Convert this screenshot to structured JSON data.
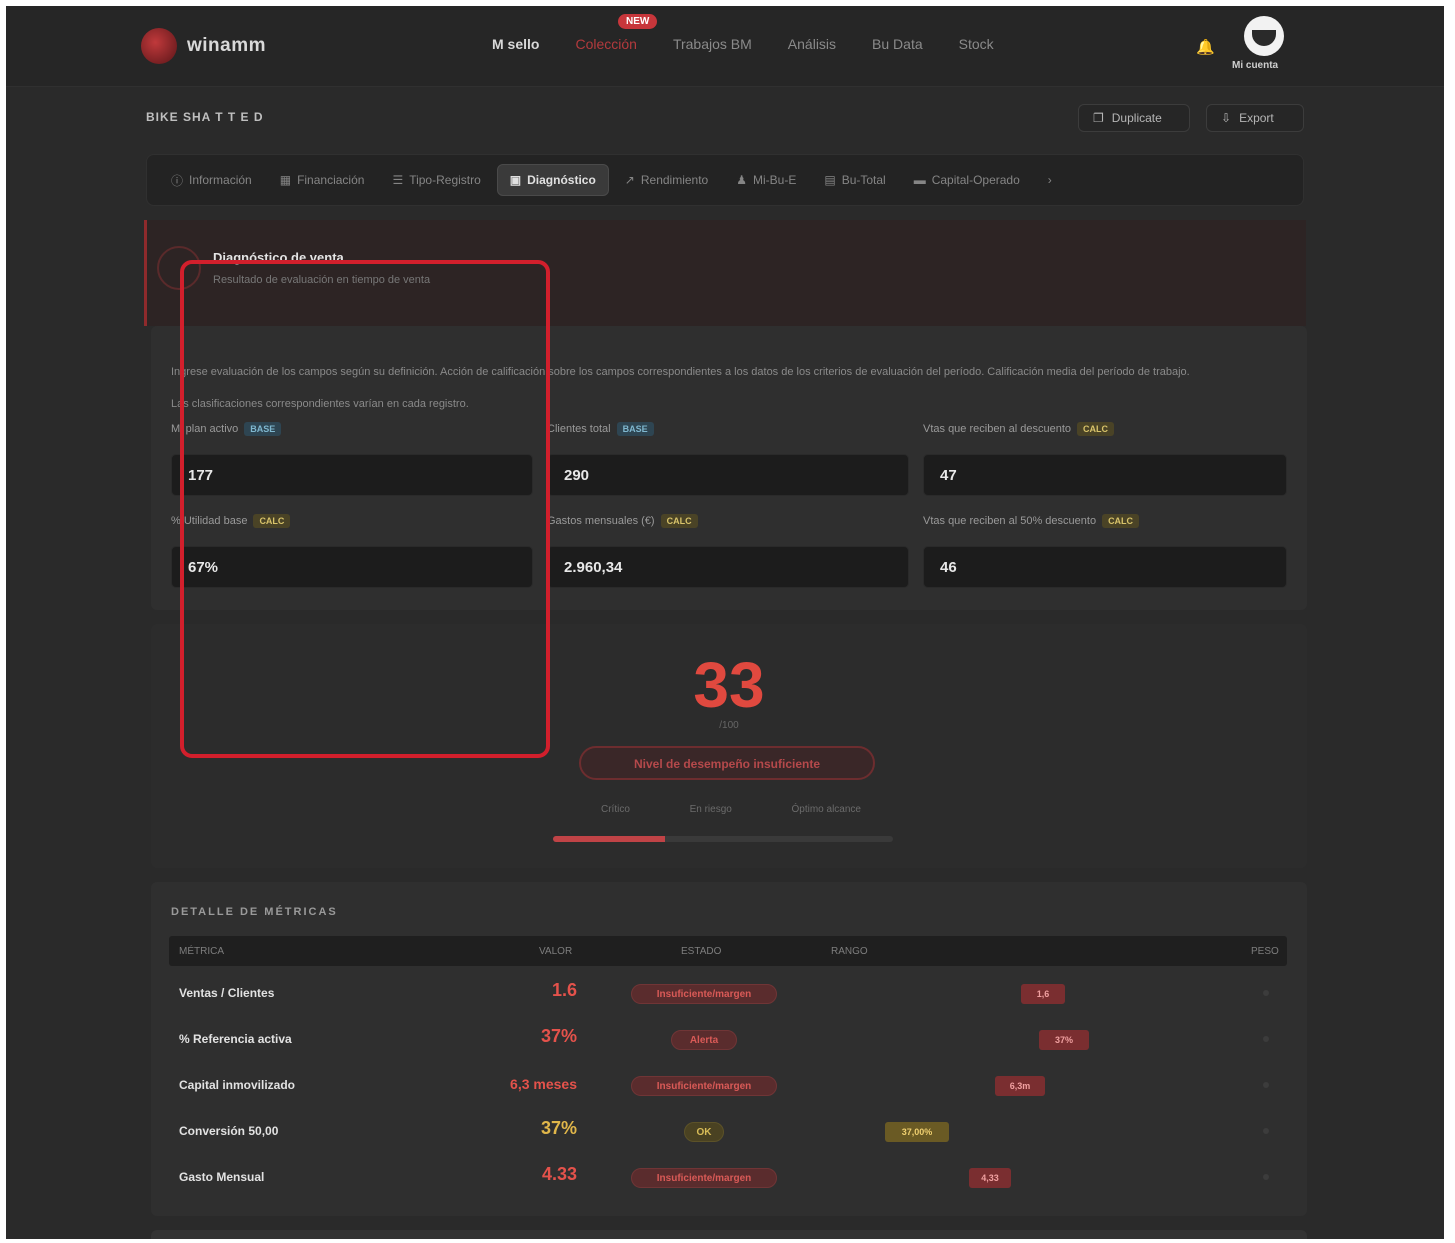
{
  "header": {
    "brand": "winamm",
    "nav": [
      {
        "label": "M sello",
        "style": "bold"
      },
      {
        "label": "Colección",
        "style": "active"
      },
      {
        "label": "Trabajos BM",
        "style": ""
      },
      {
        "label": "Análisis",
        "style": ""
      },
      {
        "label": "Bu Data",
        "style": ""
      },
      {
        "label": "Stock",
        "style": ""
      }
    ],
    "nav_badge": "NEW",
    "avatar_label": "Mi cuenta"
  },
  "page": {
    "title": "BIKE SHA T T E D",
    "buttons": [
      {
        "label": "Duplicate",
        "icon": "copy-icon"
      },
      {
        "label": "Export",
        "icon": "download-icon"
      }
    ]
  },
  "tabs": [
    {
      "label": "Información",
      "icon": "info-icon"
    },
    {
      "label": "Financiación",
      "icon": "calendar-icon"
    },
    {
      "label": "Tipo-Registro",
      "icon": "list-icon"
    },
    {
      "label": "Diagnóstico",
      "icon": "chart-icon",
      "active": true
    },
    {
      "label": "Rendimiento",
      "icon": "trend-icon"
    },
    {
      "label": "Mi-Bu-E",
      "icon": "user-icon"
    },
    {
      "label": "Bu-Total",
      "icon": "doc-icon"
    },
    {
      "label": "Capital-Operado",
      "icon": "bank-icon"
    }
  ],
  "alert": {
    "title": "Diagnóstico de venta",
    "subtitle": "Resultado de evaluación en tiempo de venta"
  },
  "form": {
    "description": "Ingrese evaluación de los campos según su definición. Acción de calificación sobre los campos correspondientes a los datos de los criterios de evaluación del período. Calificación media del período de trabajo.",
    "description2": "Las clasificaciones correspondientes varían en cada registro.",
    "fields": [
      {
        "label": "Mi plan activo",
        "tag": "BASE",
        "tag_color": "blue",
        "value": "177"
      },
      {
        "label": "Clientes total",
        "tag": "BASE",
        "tag_color": "blue",
        "value": "290"
      },
      {
        "label": "Vtas que reciben al descuento",
        "tag": "CALC",
        "tag_color": "yellow",
        "value": "47"
      },
      {
        "label": "% Utilidad base",
        "tag": "CALC",
        "tag_color": "yellow",
        "value": "67%"
      },
      {
        "label": "Gastos mensuales (€)",
        "tag": "CALC",
        "tag_color": "yellow",
        "value": "2.960,34"
      },
      {
        "label": "Vtas que reciben al 50% descuento",
        "tag": "CALC",
        "tag_color": "yellow",
        "value": "46"
      }
    ]
  },
  "score": {
    "value": "33",
    "sub": "/100",
    "status": "Nivel de desempeño insuficiente",
    "scale": [
      "Crítico",
      "En riesgo",
      "Óptimo alcance"
    ],
    "progress": 0.33
  },
  "metrics": {
    "title": "DETALLE DE MÉTRICAS",
    "headers": [
      "MÉTRICA",
      "VALOR",
      "ESTADO",
      "RANGO",
      "PESO"
    ],
    "rows": [
      {
        "name": "Ventas / Clientes",
        "value": "1.6",
        "value_color": "red",
        "status": "Insuficiente/margen",
        "status_color": "red",
        "mark": "1,6",
        "mark_color": "red"
      },
      {
        "name": "% Referencia activa",
        "value": "37%",
        "value_color": "red",
        "status": "Alerta",
        "status_color": "red",
        "mark": "37%",
        "mark_color": "red"
      },
      {
        "name": "Capital inmovilizado",
        "value": "6,3 meses",
        "value_color": "red",
        "status": "Insuficiente/margen",
        "status_color": "red",
        "mark": "6,3m",
        "mark_color": "red"
      },
      {
        "name": "Conversión 50,00",
        "value": "37%",
        "value_color": "yellow",
        "status": "OK",
        "status_color": "yellow",
        "mark": "37,00%",
        "mark_color": "yellow"
      },
      {
        "name": "Gasto Mensual",
        "value": "4.33",
        "value_color": "red",
        "status": "Insuficiente/margen",
        "status_color": "red",
        "mark": "4,33",
        "mark_color": "red"
      }
    ]
  }
}
